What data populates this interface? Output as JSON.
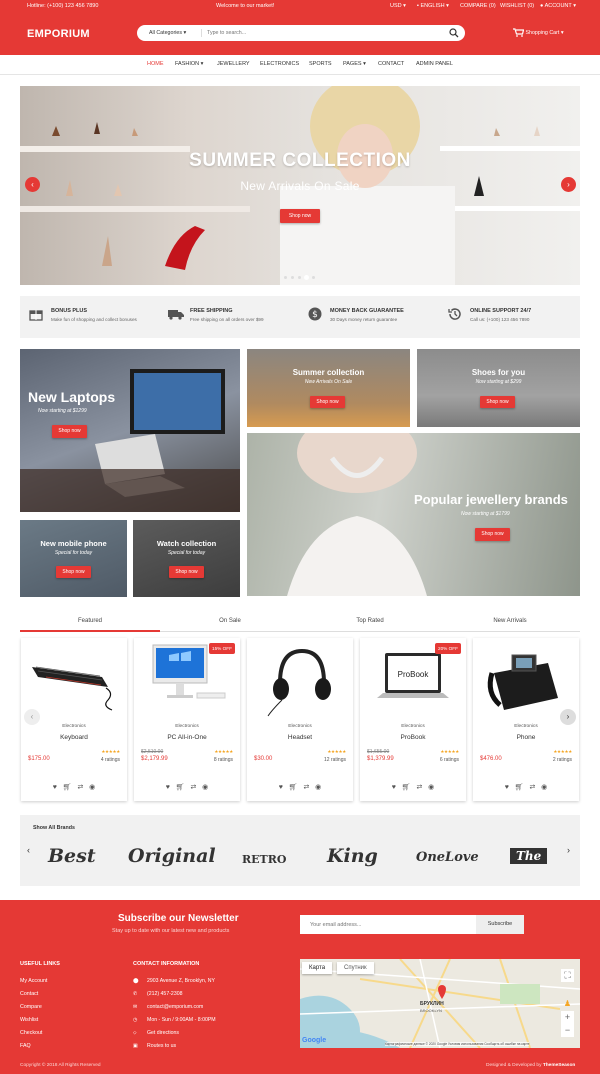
{
  "topbar": {
    "hotline": "Hotline: (+100) 123 456 7890",
    "welcome": "Welcome to our market!",
    "currency": "USD",
    "language": "ENGLISH",
    "compare": "COMPARE (0)",
    "wishlist": "WISHLIST (0)",
    "account": "ACCOUNT"
  },
  "header": {
    "logo": "EMPORIUM",
    "category": "All Categories",
    "search_placeholder": "Type to search...",
    "cart": "Shopping Cart"
  },
  "nav": [
    "HOME",
    "FASHION",
    "JEWELLERY",
    "ELECTRONICS",
    "SPORTS",
    "PAGES",
    "CONTACT",
    "ADMIN PANEL"
  ],
  "hero": {
    "title": "SUMMER COLLECTION",
    "subtitle": "New Arrivals On Sale",
    "button": "Shop now",
    "slide_active": 3,
    "slide_count": 5
  },
  "features": [
    {
      "title": "BONUS PLUS",
      "text": "Make fun of shopping and collect bonuses",
      "icon": "gift-icon"
    },
    {
      "title": "FREE SHIPPING",
      "text": "Free shipping on all orders over $99",
      "icon": "truck-icon"
    },
    {
      "title": "MONEY BACK GUARANTEE",
      "text": "30 Days money return guarantee",
      "icon": "dollar-icon"
    },
    {
      "title": "ONLINE SUPPORT 24/7",
      "text": "Call us: (+100) 123 456 7890",
      "icon": "history-icon"
    }
  ],
  "promos": [
    {
      "title": "New Laptops",
      "subtitle": "Now starting at $1299",
      "button": "Shop now"
    },
    {
      "title": "Summer collection",
      "subtitle": "New Arrivals On Sale",
      "button": "Shop now"
    },
    {
      "title": "Shoes for you",
      "subtitle": "Now starting at $299",
      "button": "Shop now"
    },
    {
      "title": "Popular jewellery brands",
      "subtitle": "Now starting at $1799",
      "button": "Shop now"
    },
    {
      "title": "New mobile phone",
      "subtitle": "Special for today",
      "button": "Shop now"
    },
    {
      "title": "Watch collection",
      "subtitle": "Special for today",
      "button": "Shop now"
    }
  ],
  "tabs": [
    "Featured",
    "On Sale",
    "Top Rated",
    "New Arrivals"
  ],
  "products": [
    {
      "category": "Electronics",
      "name": "Keyboard",
      "old": "",
      "price": "$175.00",
      "ratings": "4 ratings",
      "badge": ""
    },
    {
      "category": "Electronics",
      "name": "PC All-in-One",
      "old": "$2,510.00",
      "price": "$2,179.99",
      "ratings": "8 ratings",
      "badge": "15% OFF"
    },
    {
      "category": "Electronics",
      "name": "Headset",
      "old": "",
      "price": "$30.00",
      "ratings": "12 ratings",
      "badge": ""
    },
    {
      "category": "Electronics",
      "name": "ProBook",
      "old": "$1,655.00",
      "price": "$1,379.99",
      "ratings": "6 ratings",
      "badge": "20% OFF",
      "screen_text": "ProBook"
    },
    {
      "category": "Electronics",
      "name": "Phone",
      "old": "",
      "price": "$476.00",
      "ratings": "2 ratings",
      "badge": ""
    }
  ],
  "brands": {
    "heading": "Show All Brands",
    "logos": [
      "Best",
      "Original",
      "RETRO",
      "King",
      "OneLove",
      "The"
    ]
  },
  "newsletter": {
    "title": "Subscribe our Newsletter",
    "subtitle": "Stay up to date with our latest new and products",
    "placeholder": "Your email address...",
    "button": "Subscribe"
  },
  "useful_links": {
    "title": "USEFUL LINKS",
    "items": [
      "My Account",
      "Contact",
      "Compare",
      "Wishlist",
      "Checkout",
      "FAQ"
    ]
  },
  "contact": {
    "title": "CONTACT INFORMATION",
    "items": [
      {
        "icon": "location-icon",
        "text": "2903 Avenue Z, Brooklyn, NY"
      },
      {
        "icon": "phone-icon",
        "text": "(212) 457-2308"
      },
      {
        "icon": "mail-icon",
        "text": "contact@emporium.com"
      },
      {
        "icon": "clock-icon",
        "text": "Mon - Sun / 9:00AM - 8:00PM"
      },
      {
        "icon": "directions-icon",
        "text": "Get directions"
      },
      {
        "icon": "bus-icon",
        "text": "Routes to us"
      }
    ]
  },
  "map": {
    "tab_map": "Карта",
    "tab_sat": "Спутник",
    "place": "БРУКЛИН",
    "place_en": "BROOKLYN",
    "google": "Google",
    "footer_text": "Картографические данные © 2020 Google   Условия использования   Сообщить об ошибке на карте"
  },
  "footer": {
    "copyright": "Copyright © 2018 All Rights Reserved",
    "credit": "Designed & Developed by",
    "credit_brand": "ThemeSeason"
  },
  "colors": {
    "brand": "#e53935",
    "star": "#f5a623"
  }
}
